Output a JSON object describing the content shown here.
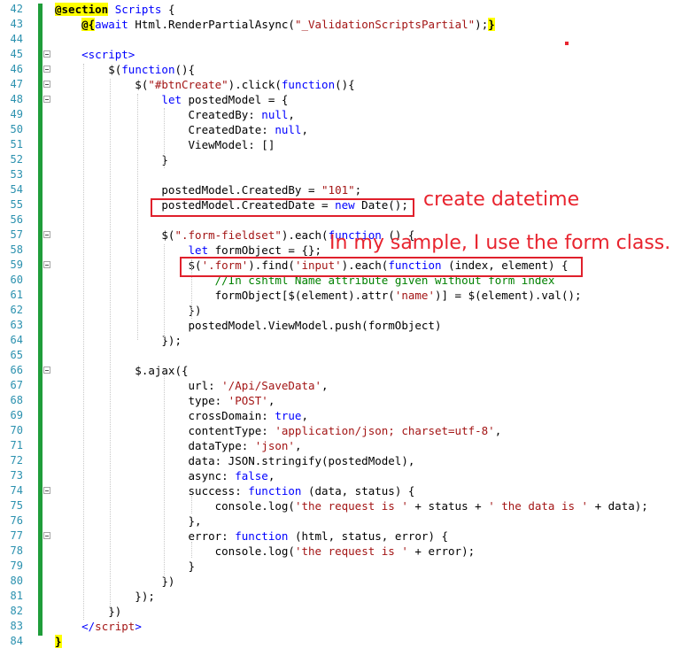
{
  "editor": {
    "line_numbers": [
      "42",
      "43",
      "44",
      "45",
      "46",
      "47",
      "48",
      "49",
      "50",
      "51",
      "52",
      "53",
      "54",
      "55",
      "56",
      "57",
      "58",
      "59",
      "60",
      "61",
      "62",
      "63",
      "64",
      "65",
      "66",
      "67",
      "68",
      "69",
      "70",
      "71",
      "72",
      "73",
      "74",
      "75",
      "76",
      "77",
      "78",
      "79",
      "80",
      "81",
      "82",
      "83",
      "84"
    ],
    "lines": [
      [
        {
          "t": "@section",
          "c": "raz"
        },
        {
          "t": " "
        },
        {
          "t": "Scripts",
          "c": "kw"
        },
        {
          "t": " {"
        }
      ],
      [
        {
          "t": "    "
        },
        {
          "t": "@{",
          "c": "raz"
        },
        {
          "t": "await",
          "c": "kw"
        },
        {
          "t": " Html.RenderPartialAsync("
        },
        {
          "t": "\"_ValidationScriptsPartial\"",
          "c": "str"
        },
        {
          "t": ");"
        },
        {
          "t": "}",
          "c": "raz"
        }
      ],
      [
        {
          "t": ""
        }
      ],
      [
        {
          "t": "    "
        },
        {
          "t": "<script>",
          "c": "kw"
        }
      ],
      [
        {
          "t": "        $("
        },
        {
          "t": "function",
          "c": "kw"
        },
        {
          "t": "(){"
        }
      ],
      [
        {
          "t": "            $("
        },
        {
          "t": "\"#btnCreate\"",
          "c": "str"
        },
        {
          "t": ").click("
        },
        {
          "t": "function",
          "c": "kw"
        },
        {
          "t": "(){"
        }
      ],
      [
        {
          "t": "                "
        },
        {
          "t": "let",
          "c": "kw"
        },
        {
          "t": " postedModel = {"
        }
      ],
      [
        {
          "t": "                    CreatedBy: "
        },
        {
          "t": "null",
          "c": "kw"
        },
        {
          "t": ","
        }
      ],
      [
        {
          "t": "                    CreatedDate: "
        },
        {
          "t": "null",
          "c": "kw"
        },
        {
          "t": ","
        }
      ],
      [
        {
          "t": "                    ViewModel: []"
        }
      ],
      [
        {
          "t": "                }"
        }
      ],
      [
        {
          "t": ""
        }
      ],
      [
        {
          "t": "                postedModel.CreatedBy = "
        },
        {
          "t": "\"101\"",
          "c": "str"
        },
        {
          "t": ";"
        }
      ],
      [
        {
          "t": "                postedModel.CreatedDate = "
        },
        {
          "t": "new",
          "c": "kw"
        },
        {
          "t": " Date();"
        }
      ],
      [
        {
          "t": ""
        }
      ],
      [
        {
          "t": "                $("
        },
        {
          "t": "\".form-fieldset\"",
          "c": "str"
        },
        {
          "t": ").each("
        },
        {
          "t": "function",
          "c": "kw"
        },
        {
          "t": " () {"
        }
      ],
      [
        {
          "t": "                    "
        },
        {
          "t": "let",
          "c": "kw"
        },
        {
          "t": " formObject = {};"
        }
      ],
      [
        {
          "t": "                    $("
        },
        {
          "t": "'.form'",
          "c": "str"
        },
        {
          "t": ").find("
        },
        {
          "t": "'input'",
          "c": "str"
        },
        {
          "t": ").each("
        },
        {
          "t": "function",
          "c": "kw"
        },
        {
          "t": " (index, element) {"
        }
      ],
      [
        {
          "t": "                        "
        },
        {
          "t": "//In cshtml Name attribute given without form index",
          "c": "cm"
        }
      ],
      [
        {
          "t": "                        formObject[$(element).attr("
        },
        {
          "t": "'name'",
          "c": "str"
        },
        {
          "t": ")] = $(element).val();"
        }
      ],
      [
        {
          "t": "                    })"
        }
      ],
      [
        {
          "t": "                    postedModel.ViewModel.push(formObject)"
        }
      ],
      [
        {
          "t": "                });"
        }
      ],
      [
        {
          "t": ""
        }
      ],
      [
        {
          "t": "            $.ajax({"
        }
      ],
      [
        {
          "t": "                    url: "
        },
        {
          "t": "'/Api/SaveData'",
          "c": "str"
        },
        {
          "t": ","
        }
      ],
      [
        {
          "t": "                    type: "
        },
        {
          "t": "'POST'",
          "c": "str"
        },
        {
          "t": ","
        }
      ],
      [
        {
          "t": "                    crossDomain: "
        },
        {
          "t": "true",
          "c": "kw"
        },
        {
          "t": ","
        }
      ],
      [
        {
          "t": "                    contentType: "
        },
        {
          "t": "'application/json; charset=utf-8'",
          "c": "str"
        },
        {
          "t": ","
        }
      ],
      [
        {
          "t": "                    dataType: "
        },
        {
          "t": "'json'",
          "c": "str"
        },
        {
          "t": ","
        }
      ],
      [
        {
          "t": "                    data: JSON.stringify(postedModel),"
        }
      ],
      [
        {
          "t": "                    async: "
        },
        {
          "t": "false",
          "c": "kw"
        },
        {
          "t": ","
        }
      ],
      [
        {
          "t": "                    success: "
        },
        {
          "t": "function",
          "c": "kw"
        },
        {
          "t": " (data, status) {"
        }
      ],
      [
        {
          "t": "                        console.log("
        },
        {
          "t": "'the request is '",
          "c": "str"
        },
        {
          "t": " + status + "
        },
        {
          "t": "' the data is '",
          "c": "str"
        },
        {
          "t": " + data);"
        }
      ],
      [
        {
          "t": "                    },"
        }
      ],
      [
        {
          "t": "                    error: "
        },
        {
          "t": "function",
          "c": "kw"
        },
        {
          "t": " (html, status, error) {"
        }
      ],
      [
        {
          "t": "                        console.log("
        },
        {
          "t": "'the request is '",
          "c": "str"
        },
        {
          "t": " + error);"
        }
      ],
      [
        {
          "t": "                    }"
        }
      ],
      [
        {
          "t": "                })"
        }
      ],
      [
        {
          "t": "            });"
        }
      ],
      [
        {
          "t": "        })"
        }
      ],
      [
        {
          "t": "    "
        },
        {
          "t": "</",
          "c": "kw"
        },
        {
          "t": "script",
          "c": "str"
        },
        {
          "t": ">",
          "c": "kw"
        }
      ],
      [
        {
          "t": "}",
          "c": "raz"
        }
      ]
    ],
    "colors": {
      "line_number": "#2b91af",
      "keyword": "#0000ff",
      "string": "#a31515",
      "comment": "#008000",
      "change_bar": "#1f9d3a",
      "annotation": "#e8242f"
    }
  },
  "annotations": {
    "create_datetime": "create datetime",
    "form_class": "In my sample, I use the form class."
  }
}
